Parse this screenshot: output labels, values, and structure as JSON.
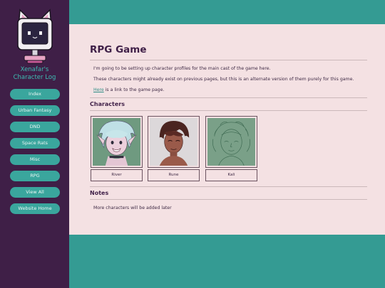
{
  "sidebar": {
    "site_title_line1": "Xenafar's",
    "site_title_line2": "Character Log",
    "nav": [
      {
        "label": "Index"
      },
      {
        "label": "Urban Fantasy"
      },
      {
        "label": "DND"
      },
      {
        "label": "Space Rats"
      },
      {
        "label": "Misc"
      },
      {
        "label": "RPG"
      },
      {
        "label": "View All"
      },
      {
        "label": "Website Home"
      }
    ]
  },
  "main": {
    "title": "RPG Game",
    "intro": "I'm going to be setting up character profiles for the main cast of the game here.",
    "note": "These characters might already exist on previous pages, but this is an alternate version of them purely for this game.",
    "link_text": "Here",
    "link_suffix": " is a link to the game page.",
    "characters_heading": "Characters",
    "characters": [
      {
        "name": "River",
        "art": "character-portrait-icon"
      },
      {
        "name": "Rune",
        "art": "character-portrait-icon"
      },
      {
        "name": "Kali",
        "art": "character-sketch-icon"
      }
    ],
    "notes_heading": "Notes",
    "notes_text": "More characters will be added later"
  },
  "colors": {
    "teal": "#349b93",
    "sidebar": "#3f1f47",
    "content_bg": "#f4e1e3",
    "button": "#3aa69d",
    "title_text": "#3dbdb2"
  }
}
